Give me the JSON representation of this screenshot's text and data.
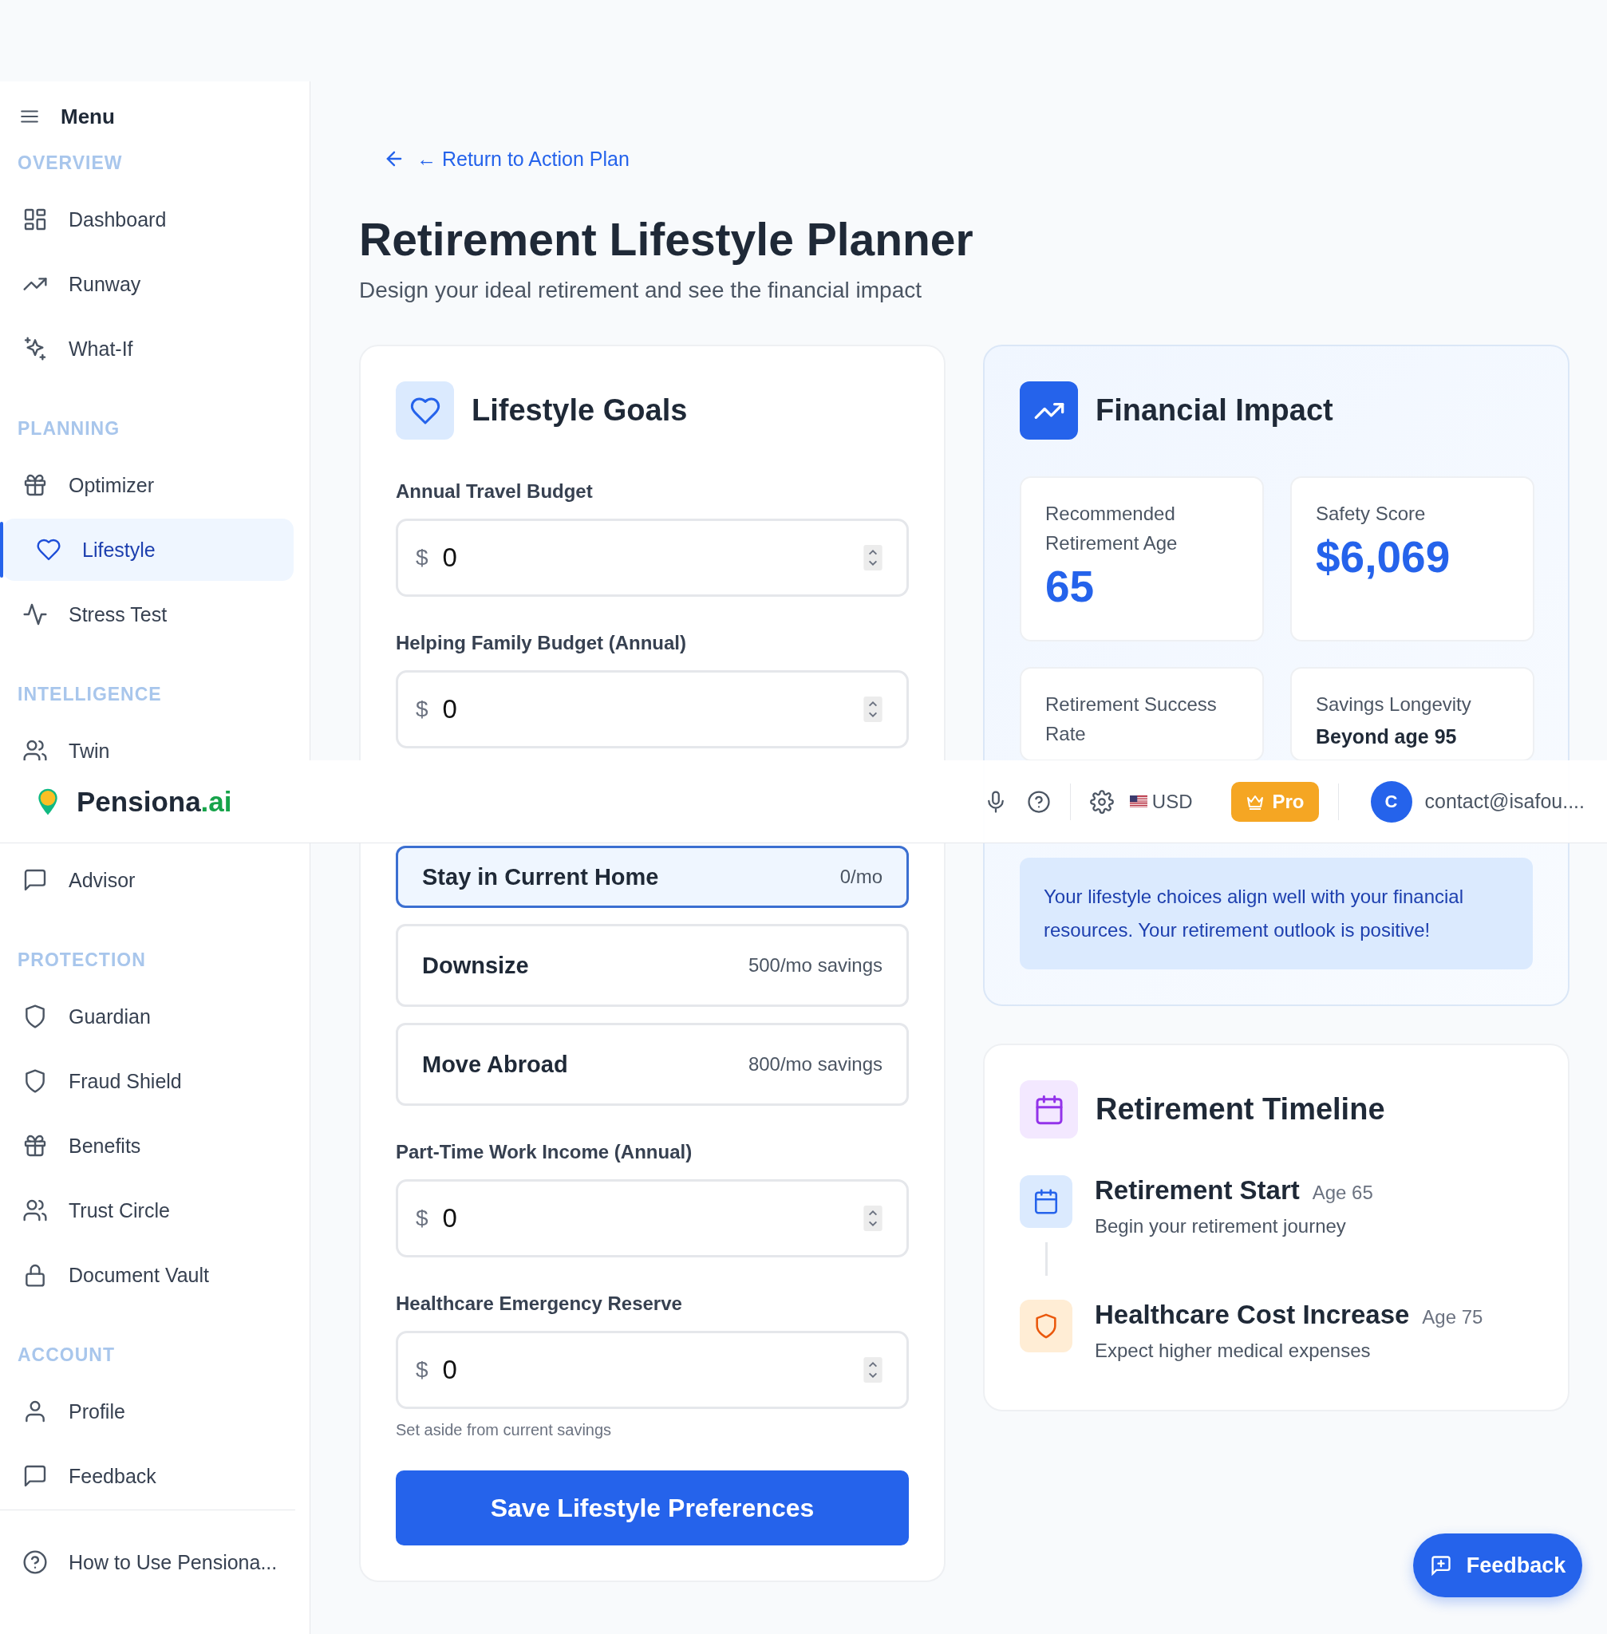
{
  "sidebar": {
    "title": "Menu",
    "sections": [
      {
        "heading": "OVERVIEW",
        "items": [
          {
            "label": "Dashboard",
            "selected": false
          },
          {
            "label": "Runway",
            "selected": false
          },
          {
            "label": "What-If",
            "selected": false
          }
        ]
      },
      {
        "heading": "PLANNING",
        "items": [
          {
            "label": "Optimizer",
            "selected": false
          },
          {
            "label": "Lifestyle",
            "selected": true
          },
          {
            "label": "Stress Test",
            "selected": false
          }
        ]
      },
      {
        "heading": "INTELLIGENCE",
        "items": [
          {
            "label": "Twin",
            "selected": false
          },
          {
            "label": "Advisor",
            "selected": false
          }
        ]
      },
      {
        "heading": "PROTECTION",
        "items": [
          {
            "label": "Guardian",
            "selected": false
          },
          {
            "label": "Fraud Shield",
            "selected": false
          },
          {
            "label": "Benefits",
            "selected": false
          },
          {
            "label": "Trust Circle",
            "selected": false
          },
          {
            "label": "Document Vault",
            "selected": false
          }
        ]
      },
      {
        "heading": "ACCOUNT",
        "items": [
          {
            "label": "Profile",
            "selected": false
          },
          {
            "label": "Feedback",
            "selected": false
          }
        ]
      }
    ],
    "help_link": "How to Use Pensiona..."
  },
  "top_bar": {
    "brand": "Pensiona",
    "brand_suffix": ".ai",
    "currency": "USD",
    "plan": "Pro",
    "avatar_initial": "C",
    "email": "contact@isafou...."
  },
  "back_link": "← Return to Action Plan",
  "page": {
    "title": "Retirement Lifestyle Planner",
    "subtitle": "Design your ideal retirement and see the financial impact"
  },
  "lifestyle_goals": {
    "title": "Lifestyle Goals",
    "fields": [
      {
        "kind": "number",
        "label": "Annual Travel Budget",
        "prefix": "$",
        "value": "0"
      },
      {
        "kind": "number",
        "label": "Helping Family Budget (Annual)",
        "prefix": "$",
        "value": "0"
      },
      {
        "kind": "choice",
        "options": [
          {
            "name": "Stay in Current Home",
            "detail": "0/mo",
            "selected": true
          },
          {
            "name": "Downsize",
            "detail": "500/mo savings",
            "selected": false
          },
          {
            "name": "Move Abroad",
            "detail": "800/mo savings",
            "selected": false
          }
        ]
      },
      {
        "kind": "number",
        "label": "Part-Time Work Income (Annual)",
        "prefix": "$",
        "value": "0"
      },
      {
        "kind": "number",
        "label": "Healthcare Emergency Reserve",
        "prefix": "$",
        "value": "0",
        "hint": "Set aside from current savings"
      }
    ],
    "save_button": "Save Lifestyle Preferences"
  },
  "financial_impact": {
    "title": "Financial Impact",
    "stats": [
      {
        "kind": "amount",
        "label": "Recommended Retirement Age",
        "value": "65"
      },
      {
        "kind": "amount",
        "label": "Safety Score",
        "value": "$6,069"
      },
      {
        "label": "Retirement Success Rate"
      },
      {
        "kind": "text",
        "label": "Savings Longevity",
        "value": "Beyond age 95"
      }
    ],
    "message": "Your lifestyle choices align well with your financial resources. Your retirement outlook is positive!"
  },
  "timeline": {
    "title": "Retirement Timeline",
    "events": [
      {
        "kind": "start",
        "title": "Retirement Start",
        "age": "Age 65",
        "description": "Begin your retirement journey"
      },
      {
        "kind": "health",
        "title": "Healthcare Cost Increase",
        "age": "Age 75",
        "description": "Expect higher medical expenses"
      }
    ]
  },
  "feedback_button": "Feedback"
}
